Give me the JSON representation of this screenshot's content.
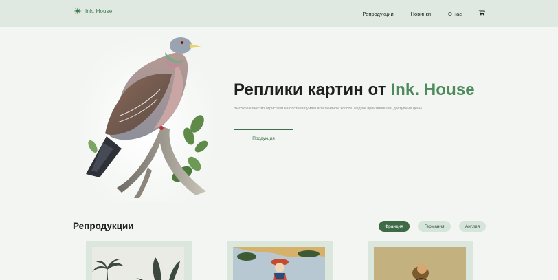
{
  "header": {
    "logo_text": "Ink. House",
    "nav": [
      {
        "label": "Репродукции"
      },
      {
        "label": "Новинки"
      },
      {
        "label": "О нас"
      }
    ],
    "cart_icon": "cart-icon"
  },
  "hero": {
    "title_prefix": "Реплики картин от ",
    "title_brand": "Ink. House",
    "subtitle": "Высокое качество отрисовки на плотной бумаге или льняном холсте. Редкие произведения, доступные цены.",
    "button_label": "Продукция"
  },
  "section": {
    "title": "Репродукции",
    "filters": [
      {
        "label": "Франция",
        "active": true
      },
      {
        "label": "Германия",
        "active": false
      },
      {
        "label": "Англия",
        "active": false
      }
    ]
  },
  "colors": {
    "accent": "#4f8a5c",
    "header_bg": "#dfe9e1",
    "page_bg": "#f2f5f2",
    "chip_active": "#3c6b46",
    "chip_idle": "#d6e5d9"
  }
}
